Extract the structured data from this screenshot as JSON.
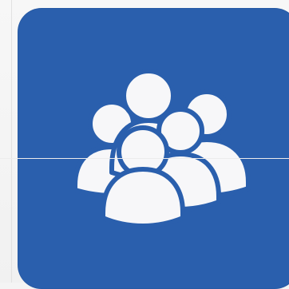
{
  "icon": {
    "name": "users-group-icon",
    "background_color": "#2a5fad",
    "glyph_color": "#f7f7f9"
  }
}
